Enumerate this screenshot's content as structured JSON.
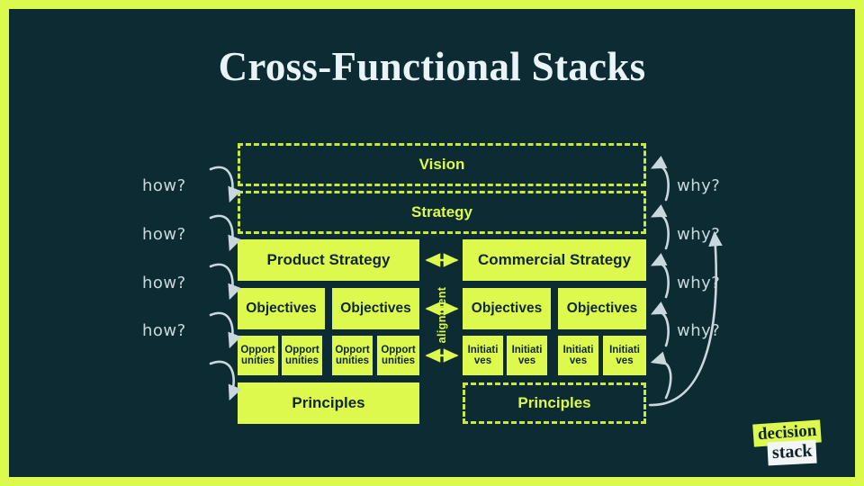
{
  "slide": {
    "title": "Cross-Functional Stacks",
    "background_color": "#0d2b33",
    "border_color": "#dcf94e",
    "accent_color": "#ddf94e",
    "text_dark": "#11252c",
    "arrow_color": "#c9d8de"
  },
  "diagram": {
    "shared": {
      "vision": "Vision",
      "strategy": "Strategy"
    },
    "alignment_label": "alignment",
    "left_stack": {
      "header": "Product Strategy",
      "objectives": [
        "Objectives",
        "Objectives"
      ],
      "leaves": [
        "Opportunities",
        "Opportunities",
        "Opportunities",
        "Opportunities"
      ],
      "leaf_lines": [
        [
          "Opport",
          "unities"
        ],
        [
          "Opport",
          "unities"
        ],
        [
          "Opport",
          "unities"
        ],
        [
          "Opport",
          "unities"
        ]
      ],
      "principles": "Principles"
    },
    "right_stack": {
      "header": "Commercial Strategy",
      "objectives": [
        "Objectives",
        "Objectives"
      ],
      "leaves": [
        "Initiatives",
        "Initiatives",
        "Initiatives",
        "Initiatives"
      ],
      "leaf_lines": [
        [
          "Initiati",
          "ves"
        ],
        [
          "Initiati",
          "ves"
        ],
        [
          "Initiati",
          "ves"
        ],
        [
          "Initiati",
          "ves"
        ]
      ],
      "principles": "Principles"
    },
    "left_labels": [
      "how?",
      "how?",
      "how?",
      "how?"
    ],
    "right_labels": [
      "why?",
      "why?",
      "why?",
      "why?"
    ]
  },
  "logo": {
    "line1": "decision",
    "line2": "stack"
  }
}
